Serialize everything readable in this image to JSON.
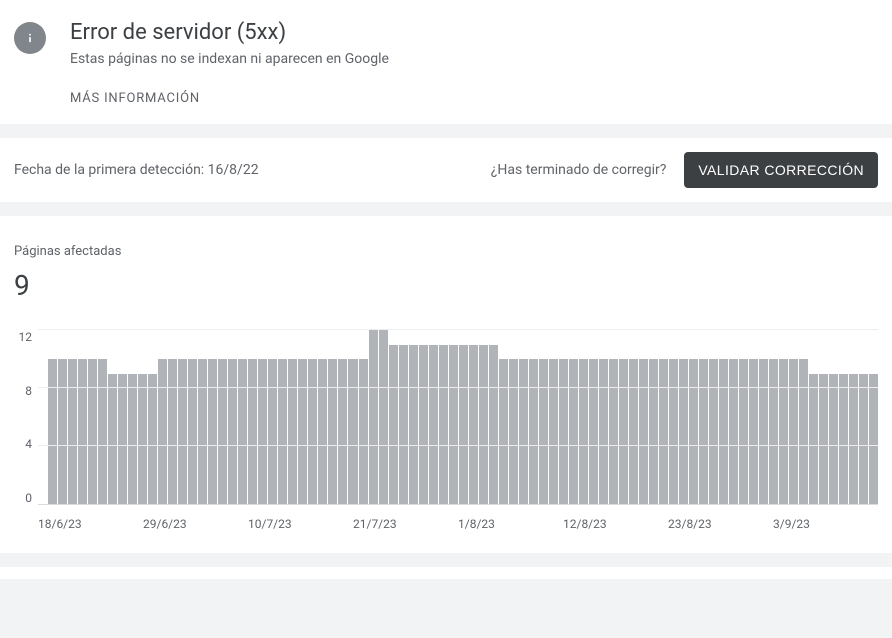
{
  "header": {
    "title": "Error de servidor (5xx)",
    "subtitle": "Estas páginas no se indexan ni aparecen en Google",
    "more_info": "MÁS INFORMACIÓN"
  },
  "action_bar": {
    "detection_label": "Fecha de la primera detección: 16/8/22",
    "fix_question": "¿Has terminado de corregir?",
    "validate_label": "VALIDAR CORRECCIÓN"
  },
  "metric": {
    "label": "Páginas afectadas",
    "value": "9"
  },
  "chart_data": {
    "type": "bar",
    "title": "Páginas afectadas",
    "xlabel": "",
    "ylabel": "",
    "ylim": [
      0,
      12
    ],
    "y_ticks": [
      12,
      8,
      4,
      0
    ],
    "x_ticks": [
      "18/6/23",
      "29/6/23",
      "10/7/23",
      "21/7/23",
      "1/8/23",
      "12/8/23",
      "23/8/23",
      "3/9/23"
    ],
    "categories": [
      "18/6/23",
      "19/6/23",
      "20/6/23",
      "21/6/23",
      "22/6/23",
      "23/6/23",
      "24/6/23",
      "25/6/23",
      "26/6/23",
      "27/6/23",
      "28/6/23",
      "29/6/23",
      "30/6/23",
      "1/7/23",
      "2/7/23",
      "3/7/23",
      "4/7/23",
      "5/7/23",
      "6/7/23",
      "7/7/23",
      "8/7/23",
      "9/7/23",
      "10/7/23",
      "11/7/23",
      "12/7/23",
      "13/7/23",
      "14/7/23",
      "15/7/23",
      "16/7/23",
      "17/7/23",
      "18/7/23",
      "19/7/23",
      "20/7/23",
      "21/7/23",
      "22/7/23",
      "23/7/23",
      "24/7/23",
      "25/7/23",
      "26/7/23",
      "27/7/23",
      "28/7/23",
      "29/7/23",
      "30/7/23",
      "31/7/23",
      "1/8/23",
      "2/8/23",
      "3/8/23",
      "4/8/23",
      "5/8/23",
      "6/8/23",
      "7/8/23",
      "8/8/23",
      "9/8/23",
      "10/8/23",
      "11/8/23",
      "12/8/23",
      "13/8/23",
      "14/8/23",
      "15/8/23",
      "16/8/23",
      "17/8/23",
      "18/8/23",
      "19/8/23",
      "20/8/23",
      "21/8/23",
      "22/8/23",
      "23/8/23",
      "24/8/23",
      "25/8/23",
      "26/8/23",
      "27/8/23",
      "28/8/23",
      "29/8/23",
      "30/8/23",
      "31/8/23",
      "1/9/23",
      "2/9/23",
      "3/9/23",
      "4/9/23",
      "5/9/23",
      "6/9/23",
      "7/9/23",
      "8/9/23",
      "9/9/23"
    ],
    "values": [
      0,
      10,
      10,
      10,
      10,
      10,
      10,
      9,
      9,
      9,
      9,
      9,
      10,
      10,
      10,
      10,
      10,
      10,
      10,
      10,
      10,
      10,
      10,
      10,
      10,
      10,
      10,
      10,
      10,
      10,
      10,
      10,
      10,
      12,
      12,
      11,
      11,
      11,
      11,
      11,
      11,
      11,
      11,
      11,
      11,
      11,
      10,
      10,
      10,
      10,
      10,
      10,
      10,
      10,
      10,
      10,
      10,
      10,
      10,
      10,
      10,
      10,
      10,
      10,
      10,
      10,
      10,
      10,
      10,
      10,
      10,
      10,
      10,
      10,
      10,
      10,
      10,
      9,
      9,
      9,
      9,
      9,
      9,
      9
    ]
  }
}
